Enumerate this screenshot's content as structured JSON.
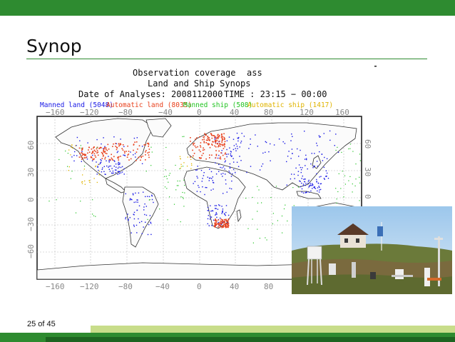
{
  "slide": {
    "title": "Synop",
    "page_indicator": "25 of 45"
  },
  "figure": {
    "heading_line1": "Observation coverage",
    "heading_suffix": "ass",
    "heading_line2": "Land and Ship Synops",
    "analysis_label": "Date of Analyses: 2008112000",
    "time_label": "TIME : 23:15 − 00:00",
    "legend": [
      {
        "label": "Manned land (5048)",
        "color": "#1a1ae6"
      },
      {
        "label": "Automatic land (8035)",
        "color": "#e8401c"
      },
      {
        "label": "Manned ship (508)",
        "color": "#22c422"
      },
      {
        "label": "Automatic ship (1417)",
        "color": "#e0b400"
      }
    ],
    "top_lon_ticks": [
      "−160",
      "−120",
      "−80",
      "−40",
      "0",
      "40",
      "80",
      "120",
      "160"
    ],
    "bottom_lon_ticks": [
      "−160",
      "−120",
      "−80",
      "−40",
      "0",
      "40",
      "80"
    ],
    "left_lat_ticks": [
      "60",
      "30",
      "0",
      "−30",
      "−60"
    ],
    "right_lat_ticks": [
      "60",
      "30",
      "0"
    ]
  },
  "colors": {
    "accent": "#2e8b30",
    "accent_dark": "#1d6420",
    "accent_light": "#c8dd8a"
  }
}
